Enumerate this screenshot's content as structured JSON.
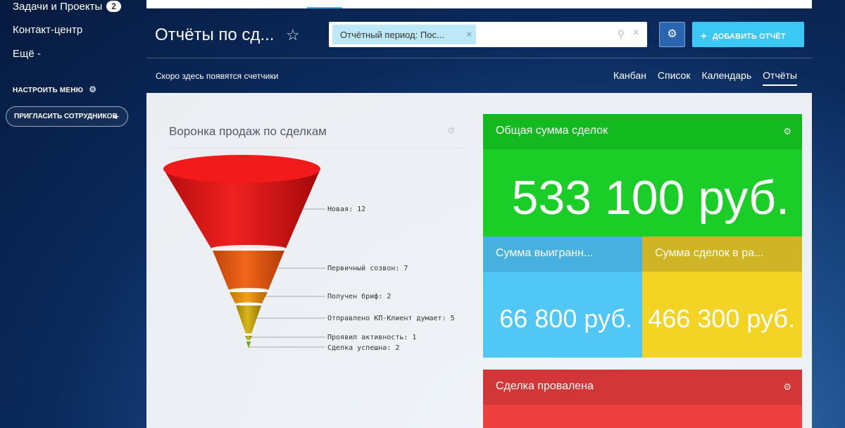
{
  "sidebar": {
    "items": [
      {
        "label": "Задачи и Проекты",
        "count": "2"
      },
      {
        "label": "Контакт-центр"
      },
      {
        "label": "Ещё -"
      }
    ],
    "setup_label": "НАСТРОИТЬ МЕНЮ",
    "invite_label": "ПРИГЛАСИТЬ СОТРУДНИКОВ"
  },
  "header": {
    "title": "Отчёты по сд...",
    "filter_chip": "Отчётный период: Пос...",
    "add_button": "ДОБАВИТЬ ОТЧЁТ",
    "subnote": "Скоро здесь появятся счетчики",
    "views": [
      "Канбан",
      "Список",
      "Календарь",
      "Отчёты"
    ],
    "active_view": "Отчёты"
  },
  "funnel": {
    "title": "Воронка продаж по сделкам",
    "stages": [
      {
        "label": "Новая: 12",
        "color": "#e01d1d"
      },
      {
        "label": "Первичный созвон: 7",
        "color": "#e4570c"
      },
      {
        "label": "Получен бриф: 2",
        "color": "#e78a08"
      },
      {
        "label": "Отправлено КП-Клиент думает: 5",
        "color": "#c8a010"
      },
      {
        "label": "Проявил активность: 1",
        "color": "#a7a418"
      },
      {
        "label": "Сделка успешна: 2",
        "color": "#6fa51b"
      }
    ]
  },
  "tiles": {
    "total": {
      "title": "Общая сумма сделок",
      "value": "533 100 руб."
    },
    "won": {
      "title": "Сумма выигранн...",
      "value": "66 800 руб."
    },
    "in_progress": {
      "title": "Сумма сделок в ра...",
      "value": "466 300 руб."
    },
    "lost": {
      "title": "Сделка провалена"
    }
  },
  "icons": [
    "gear-icon",
    "star-icon",
    "search-icon",
    "close-icon",
    "plus-icon"
  ]
}
